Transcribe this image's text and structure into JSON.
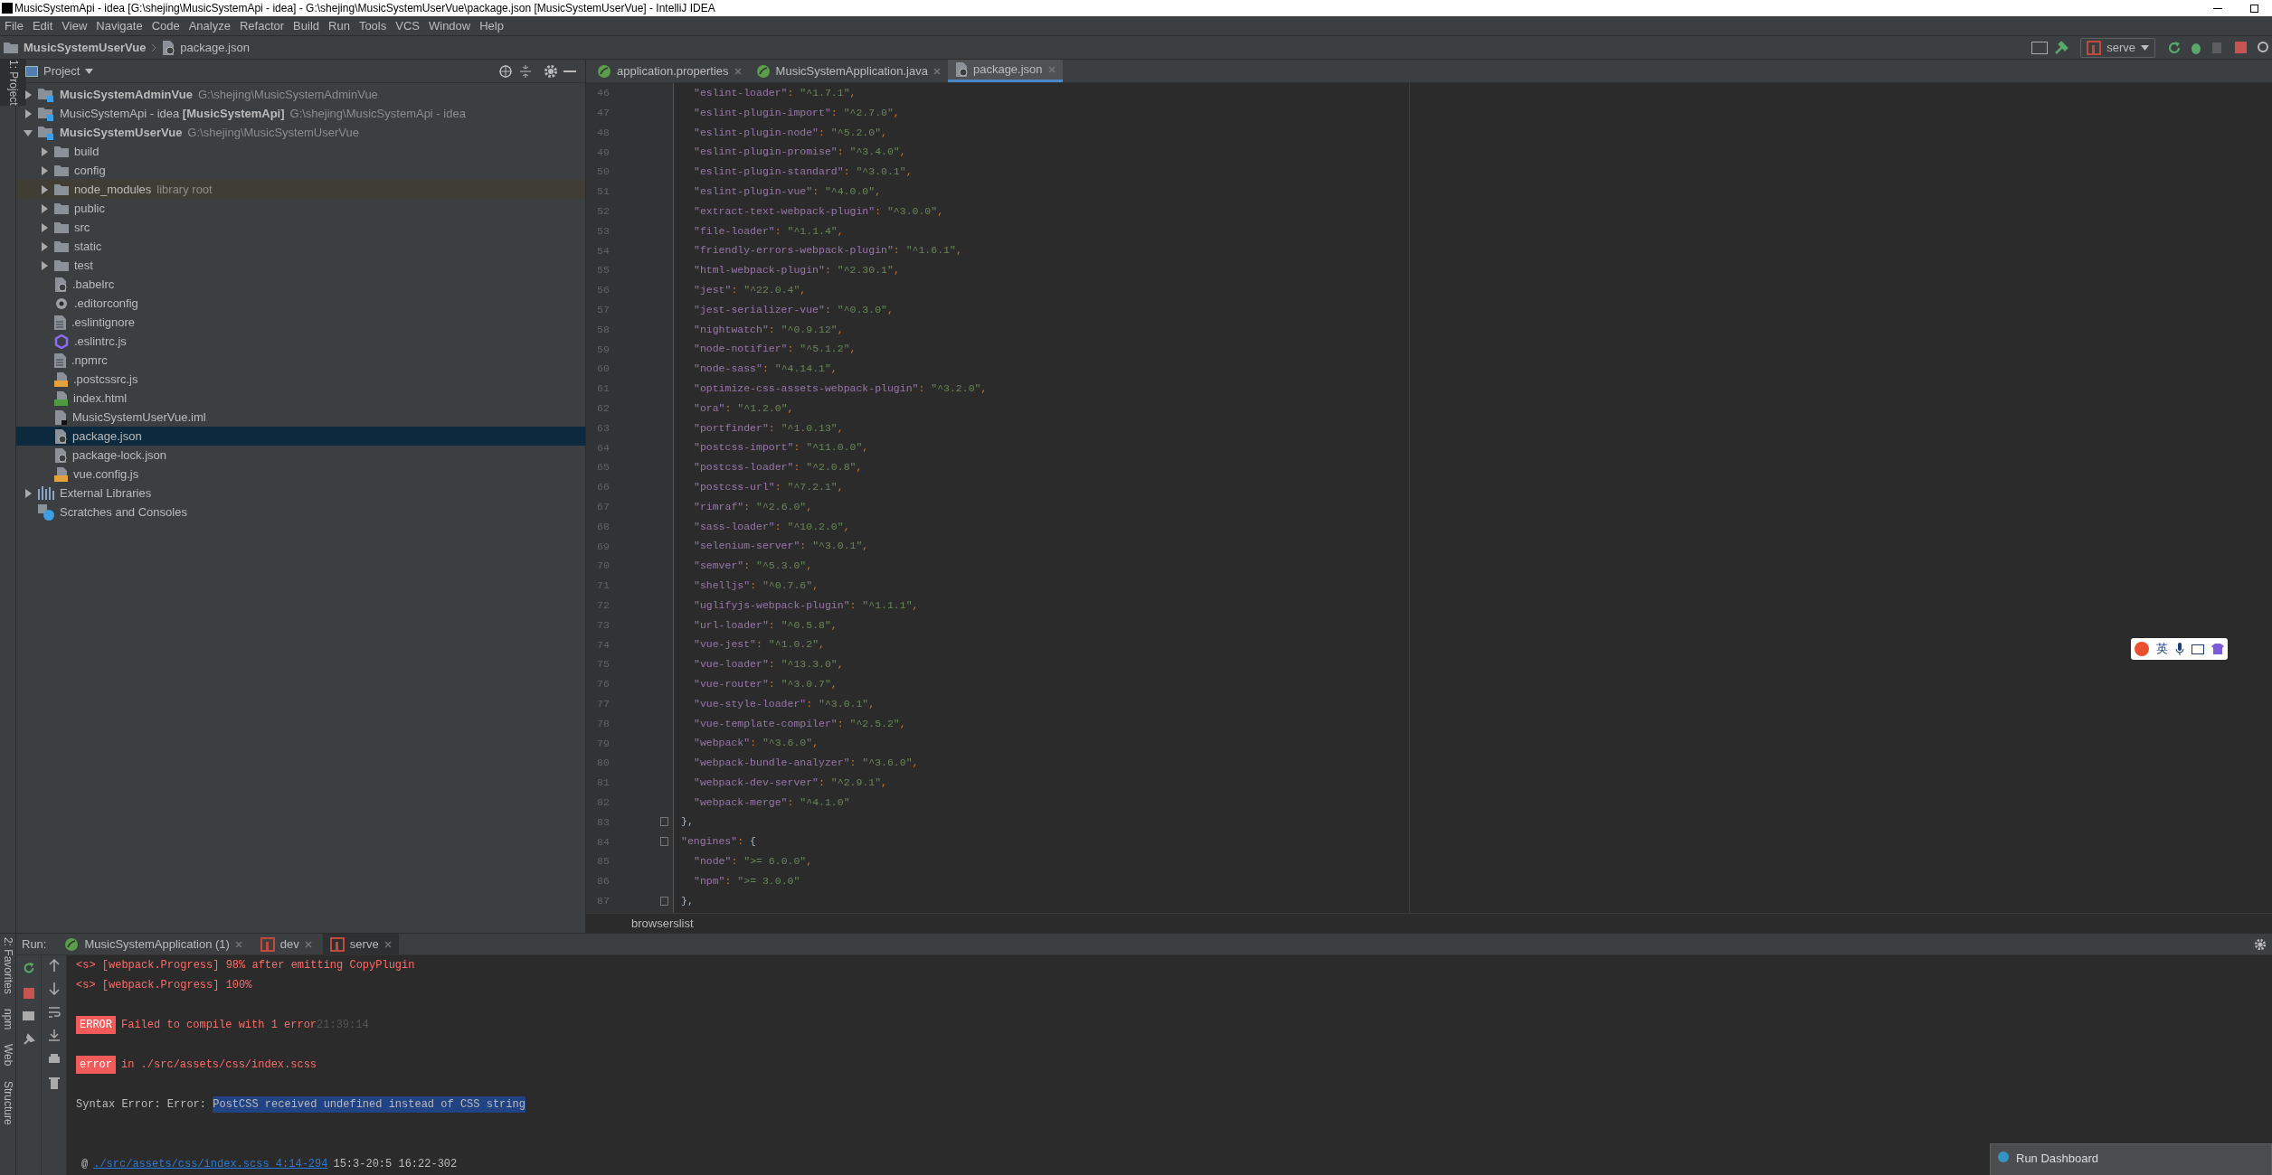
{
  "window": {
    "title": "MusicSystemApi - idea [G:\\shejing\\MusicSystemApi - idea] - G:\\shejing\\MusicSystemUserVue\\package.json [MusicSystemUserVue] - IntelliJ IDEA"
  },
  "menu": [
    "File",
    "Edit",
    "View",
    "Navigate",
    "Code",
    "Analyze",
    "Refactor",
    "Build",
    "Run",
    "Tools",
    "VCS",
    "Window",
    "Help"
  ],
  "breadcrumb": [
    "MusicSystemUserVue",
    "package.json"
  ],
  "run_config": {
    "label": "serve"
  },
  "left_strip": [
    {
      "label": "1: Project",
      "selected": true
    }
  ],
  "project": {
    "title": "Project",
    "tree": [
      {
        "label": "MusicSystemAdminVue",
        "path": "G:\\shejing\\MusicSystemAdminVue",
        "kind": "module",
        "bold": true,
        "expanded": false,
        "selected": false
      },
      {
        "label": "MusicSystemApi - idea **[MusicSystemApi]**",
        "path": "G:\\shejing\\MusicSystemApi - idea",
        "kind": "module",
        "bold": false,
        "expanded": false,
        "selected": false
      },
      {
        "label": "MusicSystemUserVue",
        "path": "G:\\shejing\\MusicSystemUserVue",
        "kind": "module",
        "bold": true,
        "expanded": true,
        "selected": false,
        "children": [
          {
            "label": "build",
            "kind": "folder",
            "expanded": false,
            "selected": false
          },
          {
            "label": "config",
            "kind": "folder",
            "expanded": false,
            "selected": false
          },
          {
            "label": "node_modules",
            "note": "library root",
            "kind": "library-folder",
            "expanded": false,
            "selected": false
          },
          {
            "label": "public",
            "kind": "folder",
            "expanded": false,
            "selected": false
          },
          {
            "label": "src",
            "kind": "folder",
            "expanded": false,
            "selected": false
          },
          {
            "label": "static",
            "kind": "folder",
            "expanded": false,
            "selected": false
          },
          {
            "label": "test",
            "kind": "folder",
            "expanded": false,
            "selected": false
          },
          {
            "label": ".babelrc",
            "kind": "json",
            "selected": false
          },
          {
            "label": ".editorconfig",
            "kind": "config",
            "selected": false
          },
          {
            "label": ".eslintignore",
            "kind": "text",
            "selected": false
          },
          {
            "label": ".eslintrc.js",
            "kind": "eslint",
            "selected": false
          },
          {
            "label": ".npmrc",
            "kind": "text",
            "selected": false
          },
          {
            "label": ".postcssrc.js",
            "kind": "js",
            "selected": false
          },
          {
            "label": "index.html",
            "kind": "html",
            "selected": false
          },
          {
            "label": "MusicSystemUserVue.iml",
            "kind": "iml",
            "selected": false
          },
          {
            "label": "package.json",
            "kind": "json",
            "selected": true
          },
          {
            "label": "package-lock.json",
            "kind": "json",
            "selected": false
          },
          {
            "label": "vue.config.js",
            "kind": "js",
            "selected": false
          }
        ]
      },
      {
        "label": "External Libraries",
        "kind": "libraries",
        "expanded": false,
        "selected": false
      },
      {
        "label": "Scratches and Consoles",
        "kind": "scratches",
        "selected": false
      }
    ]
  },
  "editor": {
    "tabs": [
      {
        "label": "application.properties",
        "kind": "spring",
        "selected": false
      },
      {
        "label": "MusicSystemApplication.java",
        "kind": "spring",
        "selected": false
      },
      {
        "label": "package.json",
        "kind": "json",
        "selected": true
      }
    ],
    "lines": [
      {
        "num": "46",
        "kind": "entry",
        "key": "\"eslint-loader\"",
        "sep": ": ",
        "value": "\"^1.7.1\"",
        "end": ","
      },
      {
        "num": "47",
        "kind": "entry",
        "key": "\"eslint-plugin-import\"",
        "sep": ": ",
        "value": "\"^2.7.0\"",
        "end": ","
      },
      {
        "num": "48",
        "kind": "entry",
        "key": "\"eslint-plugin-node\"",
        "sep": ": ",
        "value": "\"^5.2.0\"",
        "end": ","
      },
      {
        "num": "49",
        "kind": "entry",
        "key": "\"eslint-plugin-promise\"",
        "sep": ": ",
        "value": "\"^3.4.0\"",
        "end": ","
      },
      {
        "num": "50",
        "kind": "entry",
        "key": "\"eslint-plugin-standard\"",
        "sep": ": ",
        "value": "\"^3.0.1\"",
        "end": ","
      },
      {
        "num": "51",
        "kind": "entry",
        "key": "\"eslint-plugin-vue\"",
        "sep": ": ",
        "value": "\"^4.0.0\"",
        "end": ","
      },
      {
        "num": "52",
        "kind": "entry",
        "key": "\"extract-text-webpack-plugin\"",
        "sep": ": ",
        "value": "\"^3.0.0\"",
        "end": ","
      },
      {
        "num": "53",
        "kind": "entry",
        "key": "\"file-loader\"",
        "sep": ": ",
        "value": "\"^1.1.4\"",
        "end": ","
      },
      {
        "num": "54",
        "kind": "entry",
        "key": "\"friendly-errors-webpack-plugin\"",
        "sep": ": ",
        "value": "\"^1.6.1\"",
        "end": ","
      },
      {
        "num": "55",
        "kind": "entry",
        "key": "\"html-webpack-plugin\"",
        "sep": ": ",
        "value": "\"^2.30.1\"",
        "end": ","
      },
      {
        "num": "56",
        "kind": "entry",
        "key": "\"jest\"",
        "sep": ": ",
        "value": "\"^22.0.4\"",
        "end": ","
      },
      {
        "num": "57",
        "kind": "entry",
        "key": "\"jest-serializer-vue\"",
        "sep": ": ",
        "value": "\"^0.3.0\"",
        "end": ","
      },
      {
        "num": "58",
        "kind": "entry",
        "key": "\"nightwatch\"",
        "sep": ": ",
        "value": "\"^0.9.12\"",
        "end": ","
      },
      {
        "num": "59",
        "kind": "entry",
        "key": "\"node-notifier\"",
        "sep": ": ",
        "value": "\"^5.1.2\"",
        "end": ","
      },
      {
        "num": "60",
        "kind": "entry",
        "key": "\"node-sass\"",
        "sep": ": ",
        "value": "\"^4.14.1\"",
        "end": ","
      },
      {
        "num": "61",
        "kind": "entry",
        "key": "\"optimize-css-assets-webpack-plugin\"",
        "sep": ": ",
        "value": "\"^3.2.0\"",
        "end": ","
      },
      {
        "num": "62",
        "kind": "entry",
        "key": "\"ora\"",
        "sep": ": ",
        "value": "\"^1.2.0\"",
        "end": ","
      },
      {
        "num": "63",
        "kind": "entry",
        "key": "\"portfinder\"",
        "sep": ": ",
        "value": "\"^1.0.13\"",
        "end": ","
      },
      {
        "num": "64",
        "kind": "entry",
        "key": "\"postcss-import\"",
        "sep": ": ",
        "value": "\"^11.0.0\"",
        "end": ","
      },
      {
        "num": "65",
        "kind": "entry",
        "key": "\"postcss-loader\"",
        "sep": ": ",
        "value": "\"^2.0.8\"",
        "end": ","
      },
      {
        "num": "66",
        "kind": "entry",
        "key": "\"postcss-url\"",
        "sep": ": ",
        "value": "\"^7.2.1\"",
        "end": ","
      },
      {
        "num": "67",
        "kind": "entry",
        "key": "\"rimraf\"",
        "sep": ": ",
        "value": "\"^2.6.0\"",
        "end": ","
      },
      {
        "num": "68",
        "kind": "entry",
        "key": "\"sass-loader\"",
        "sep": ": ",
        "value": "\"^10.2.0\"",
        "end": ","
      },
      {
        "num": "69",
        "kind": "entry",
        "key": "\"selenium-server\"",
        "sep": ": ",
        "value": "\"^3.0.1\"",
        "end": ","
      },
      {
        "num": "70",
        "kind": "entry",
        "key": "\"semver\"",
        "sep": ": ",
        "value": "\"^5.3.0\"",
        "end": ","
      },
      {
        "num": "71",
        "kind": "entry",
        "key": "\"shelljs\"",
        "sep": ": ",
        "value": "\"^0.7.6\"",
        "end": ","
      },
      {
        "num": "72",
        "kind": "entry",
        "key": "\"uglifyjs-webpack-plugin\"",
        "sep": ": ",
        "value": "\"^1.1.1\"",
        "end": ","
      },
      {
        "num": "73",
        "kind": "entry",
        "key": "\"url-loader\"",
        "sep": ": ",
        "value": "\"^0.5.8\"",
        "end": ","
      },
      {
        "num": "74",
        "kind": "entry",
        "key": "\"vue-jest\"",
        "sep": ": ",
        "value": "\"^1.0.2\"",
        "end": ","
      },
      {
        "num": "75",
        "kind": "entry",
        "key": "\"vue-loader\"",
        "sep": ": ",
        "value": "\"^13.3.0\"",
        "end": ","
      },
      {
        "num": "76",
        "kind": "entry",
        "key": "\"vue-router\"",
        "sep": ": ",
        "value": "\"^3.0.7\"",
        "end": ","
      },
      {
        "num": "77",
        "kind": "entry",
        "key": "\"vue-style-loader\"",
        "sep": ": ",
        "value": "\"^3.0.1\"",
        "end": ","
      },
      {
        "num": "78",
        "kind": "entry",
        "key": "\"vue-template-compiler\"",
        "sep": ": ",
        "value": "\"^2.5.2\"",
        "end": ","
      },
      {
        "num": "79",
        "kind": "entry",
        "key": "\"webpack\"",
        "sep": ": ",
        "value": "\"^3.6.0\"",
        "end": ","
      },
      {
        "num": "80",
        "kind": "entry",
        "key": "\"webpack-bundle-analyzer\"",
        "sep": ": ",
        "value": "\"^3.6.0\"",
        "end": ","
      },
      {
        "num": "81",
        "kind": "entry",
        "key": "\"webpack-dev-server\"",
        "sep": ": ",
        "value": "\"^2.9.1\"",
        "end": ","
      },
      {
        "num": "82",
        "kind": "entry",
        "key": "\"webpack-merge\"",
        "sep": ": ",
        "value": "\"^4.1.0\""
      },
      {
        "num": "83",
        "kind": "close",
        "text": "},"
      },
      {
        "num": "84",
        "kind": "open",
        "key": "\"engines\"",
        "sep": ": ",
        "text": "{"
      },
      {
        "num": "85",
        "kind": "entry",
        "key": "\"node\"",
        "sep": ": ",
        "value": "\">= 6.0.0\"",
        "end": ","
      },
      {
        "num": "86",
        "kind": "entry",
        "key": "\"npm\"",
        "sep": ": ",
        "value": "\">= 3.0.0\""
      },
      {
        "num": "87",
        "kind": "close",
        "text": "},"
      }
    ],
    "path": "browserslist"
  },
  "run": {
    "label": "Run:",
    "tabs": [
      {
        "label": "MusicSystemApplication (1)",
        "kind": "spring",
        "selected": false
      },
      {
        "label": "dev",
        "kind": "npm",
        "selected": false
      },
      {
        "label": "serve",
        "kind": "npm",
        "selected": true
      }
    ],
    "side_strip": [
      "2: Favorites",
      "npm",
      "Web",
      "Structure"
    ],
    "console": [
      {
        "kind": "progress",
        "prefix": "<s>",
        "text": "[webpack.Progress] 98% after emitting CopyPlugin"
      },
      {
        "kind": "progress",
        "prefix": "<s>",
        "text": "[webpack.Progress] 100%"
      },
      {
        "kind": "badge",
        "badge": "ERROR",
        "text": "Failed to compile with 1 error",
        "time": "21:39:14"
      },
      {
        "kind": "badge",
        "badge": "error",
        "text": "in ./src/assets/css/index.scss"
      },
      {
        "kind": "plain",
        "text": "Syntax Error: Error: ",
        "selection": "PostCSS received undefined instead of CSS string"
      },
      {
        "kind": "link",
        "prefix": "@",
        "link": "./src/assets/css/index.scss 4:14-294",
        "text": "15:3-20:5 16:22-302"
      }
    ]
  },
  "ime_bar": {
    "label": "英"
  },
  "notification": {
    "title": "Run Dashboard"
  }
}
